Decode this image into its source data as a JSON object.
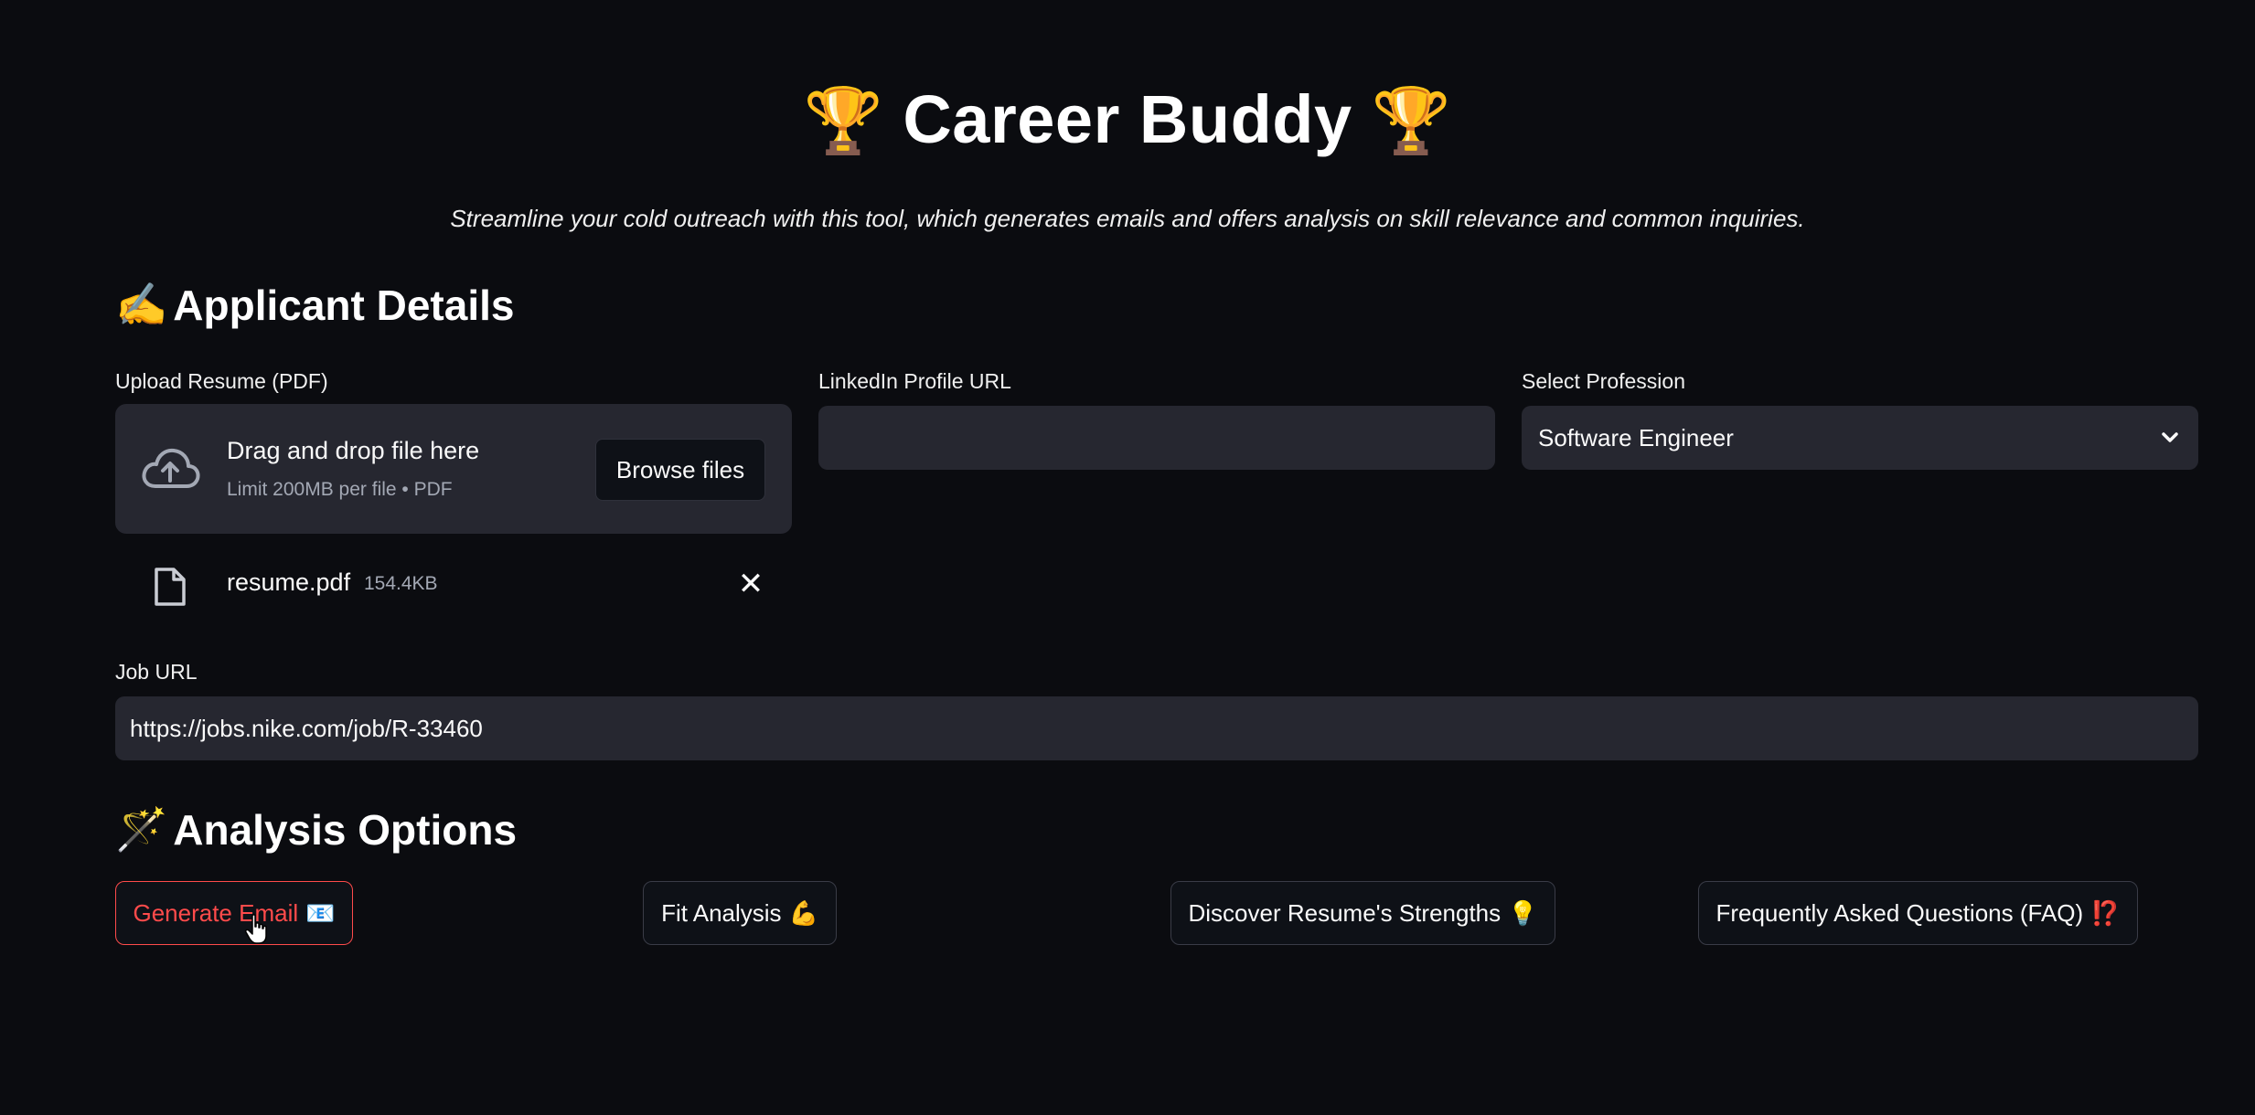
{
  "header": {
    "title": "Career Buddy",
    "title_emoji_left": "🏆",
    "title_emoji_right": "🏆",
    "subtitle": "Streamline your cold outreach with this tool, which generates emails and offers analysis on skill relevance and common inquiries."
  },
  "applicant_section": {
    "emoji": "✍️",
    "heading": "Applicant Details",
    "resume_upload": {
      "label": "Upload Resume (PDF)",
      "drop_text": "Drag and drop file here",
      "limit_text": "Limit 200MB per file • PDF",
      "browse_label": "Browse files",
      "icon": "cloud-upload-icon"
    },
    "uploaded_file": {
      "name": "resume.pdf",
      "size": "154.4KB",
      "icon": "file-icon",
      "remove_icon": "close-icon",
      "remove_glyph": "✕"
    },
    "linkedin": {
      "label": "LinkedIn Profile URL",
      "value": "",
      "placeholder": ""
    },
    "profession": {
      "label": "Select Profession",
      "selected": "Software Engineer",
      "icon": "chevron-down-icon"
    },
    "job_url": {
      "label": "Job URL",
      "value": "https://jobs.nike.com/job/R-33460"
    }
  },
  "analysis_section": {
    "emoji": "🪄",
    "heading": "Analysis Options",
    "buttons": [
      {
        "label": "Generate Email",
        "emoji": "📧",
        "state": "active"
      },
      {
        "label": "Fit Analysis",
        "emoji": "💪"
      },
      {
        "label": "Discover Resume's Strengths",
        "emoji": "💡"
      },
      {
        "label": "Frequently Asked Questions (FAQ)",
        "emoji": "⁉️"
      }
    ]
  },
  "colors": {
    "background": "#0b0c10",
    "input_bg": "#262730",
    "accent": "#ff4b4b",
    "text": "#fafafa",
    "muted_text": "#a3a8b4"
  }
}
